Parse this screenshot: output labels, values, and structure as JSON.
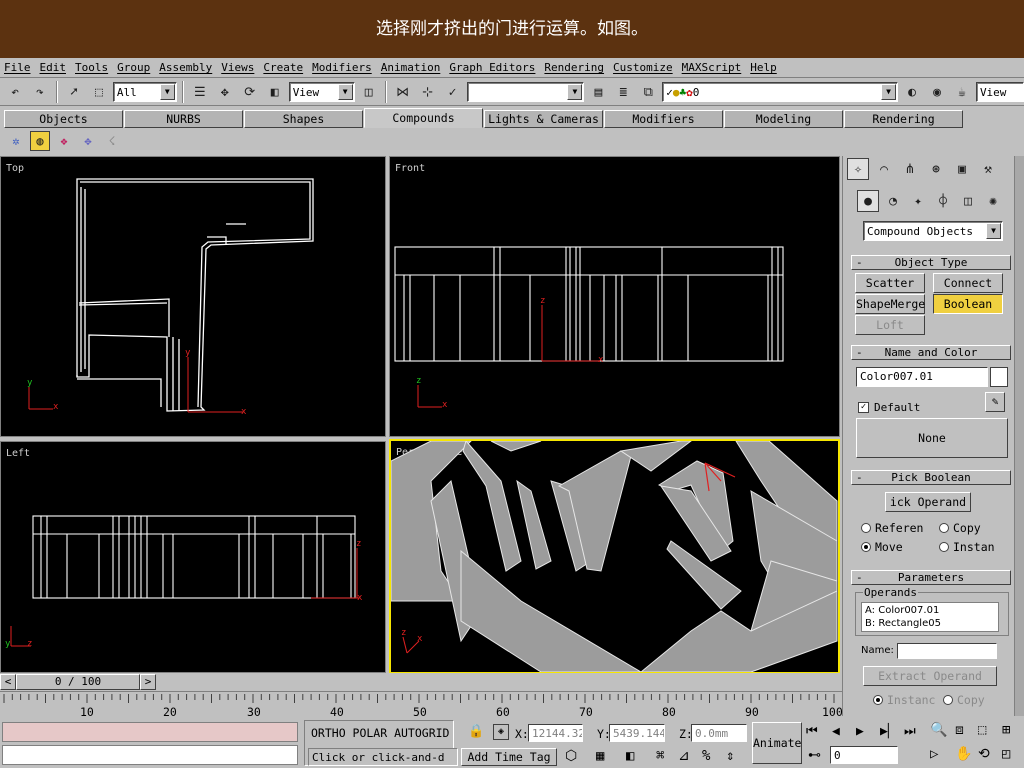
{
  "caption": "选择刚才挤出的门进行运算。如图。",
  "menu": [
    "File",
    "Edit",
    "Tools",
    "Group",
    "Assembly",
    "Views",
    "Create",
    "Modifiers",
    "Animation",
    "Graph Editors",
    "Rendering",
    "Customize",
    "MAXScript",
    "Help"
  ],
  "toolbar": {
    "selection_filter": "All",
    "coord_system": "View",
    "named_selection": "",
    "layer_value": "0",
    "view_right": "View"
  },
  "tabs": [
    "Objects",
    "NURBS",
    "Shapes",
    "Compounds",
    "Lights & Cameras",
    "Modifiers",
    "Modeling",
    "Rendering"
  ],
  "active_tab": "Compounds",
  "viewports": {
    "top": "Top",
    "front": "Front",
    "left": "Left",
    "perspective": "Perspective"
  },
  "command_panel": {
    "category": "Compound Objects",
    "object_type": {
      "title": "Object Type",
      "buttons": [
        "Scatter",
        "Connect",
        "ShapeMerge",
        "Boolean",
        "Loft"
      ],
      "active": "Boolean"
    },
    "name_color": {
      "title": "Name and Color",
      "name": "Color007.01",
      "default_label": "Default",
      "default_checked": true,
      "none_label": "None"
    },
    "pick_boolean": {
      "title": "Pick Boolean",
      "pick_button": "ick Operand",
      "options": [
        "Referen",
        "Copy",
        "Move",
        "Instan"
      ],
      "selected": "Move"
    },
    "parameters": {
      "title": "Parameters",
      "operands_label": "Operands",
      "operands": [
        "A: Color007.01",
        "B: Rectangle05"
      ],
      "name_label": "Name:",
      "name_value": "",
      "extract_button": "Extract Operand",
      "extract_options": [
        "Instanc",
        "Copy"
      ]
    }
  },
  "time": {
    "slider_text": "0 / 100",
    "ruler_labels": [
      "10",
      "20",
      "30",
      "40",
      "50",
      "60",
      "70",
      "80",
      "90",
      "100"
    ]
  },
  "status": {
    "modes": "ORTHO  POLAR  AUTOGRID",
    "x_label": "X:",
    "x_value": "12144.32",
    "y_label": "Y:",
    "y_value": "5439.144",
    "z_label": "Z:",
    "z_value": "0.0mm",
    "animate_label": "Animate",
    "prompt": "Click or click-and-d",
    "add_time_tag": "Add Time Tag",
    "frame_field": "0"
  },
  "colors": {
    "caption_bg": "#5c3210",
    "active_viewport": "#f6e600",
    "active_button": "#f0d040",
    "status_pink": "#e6c8c8"
  }
}
